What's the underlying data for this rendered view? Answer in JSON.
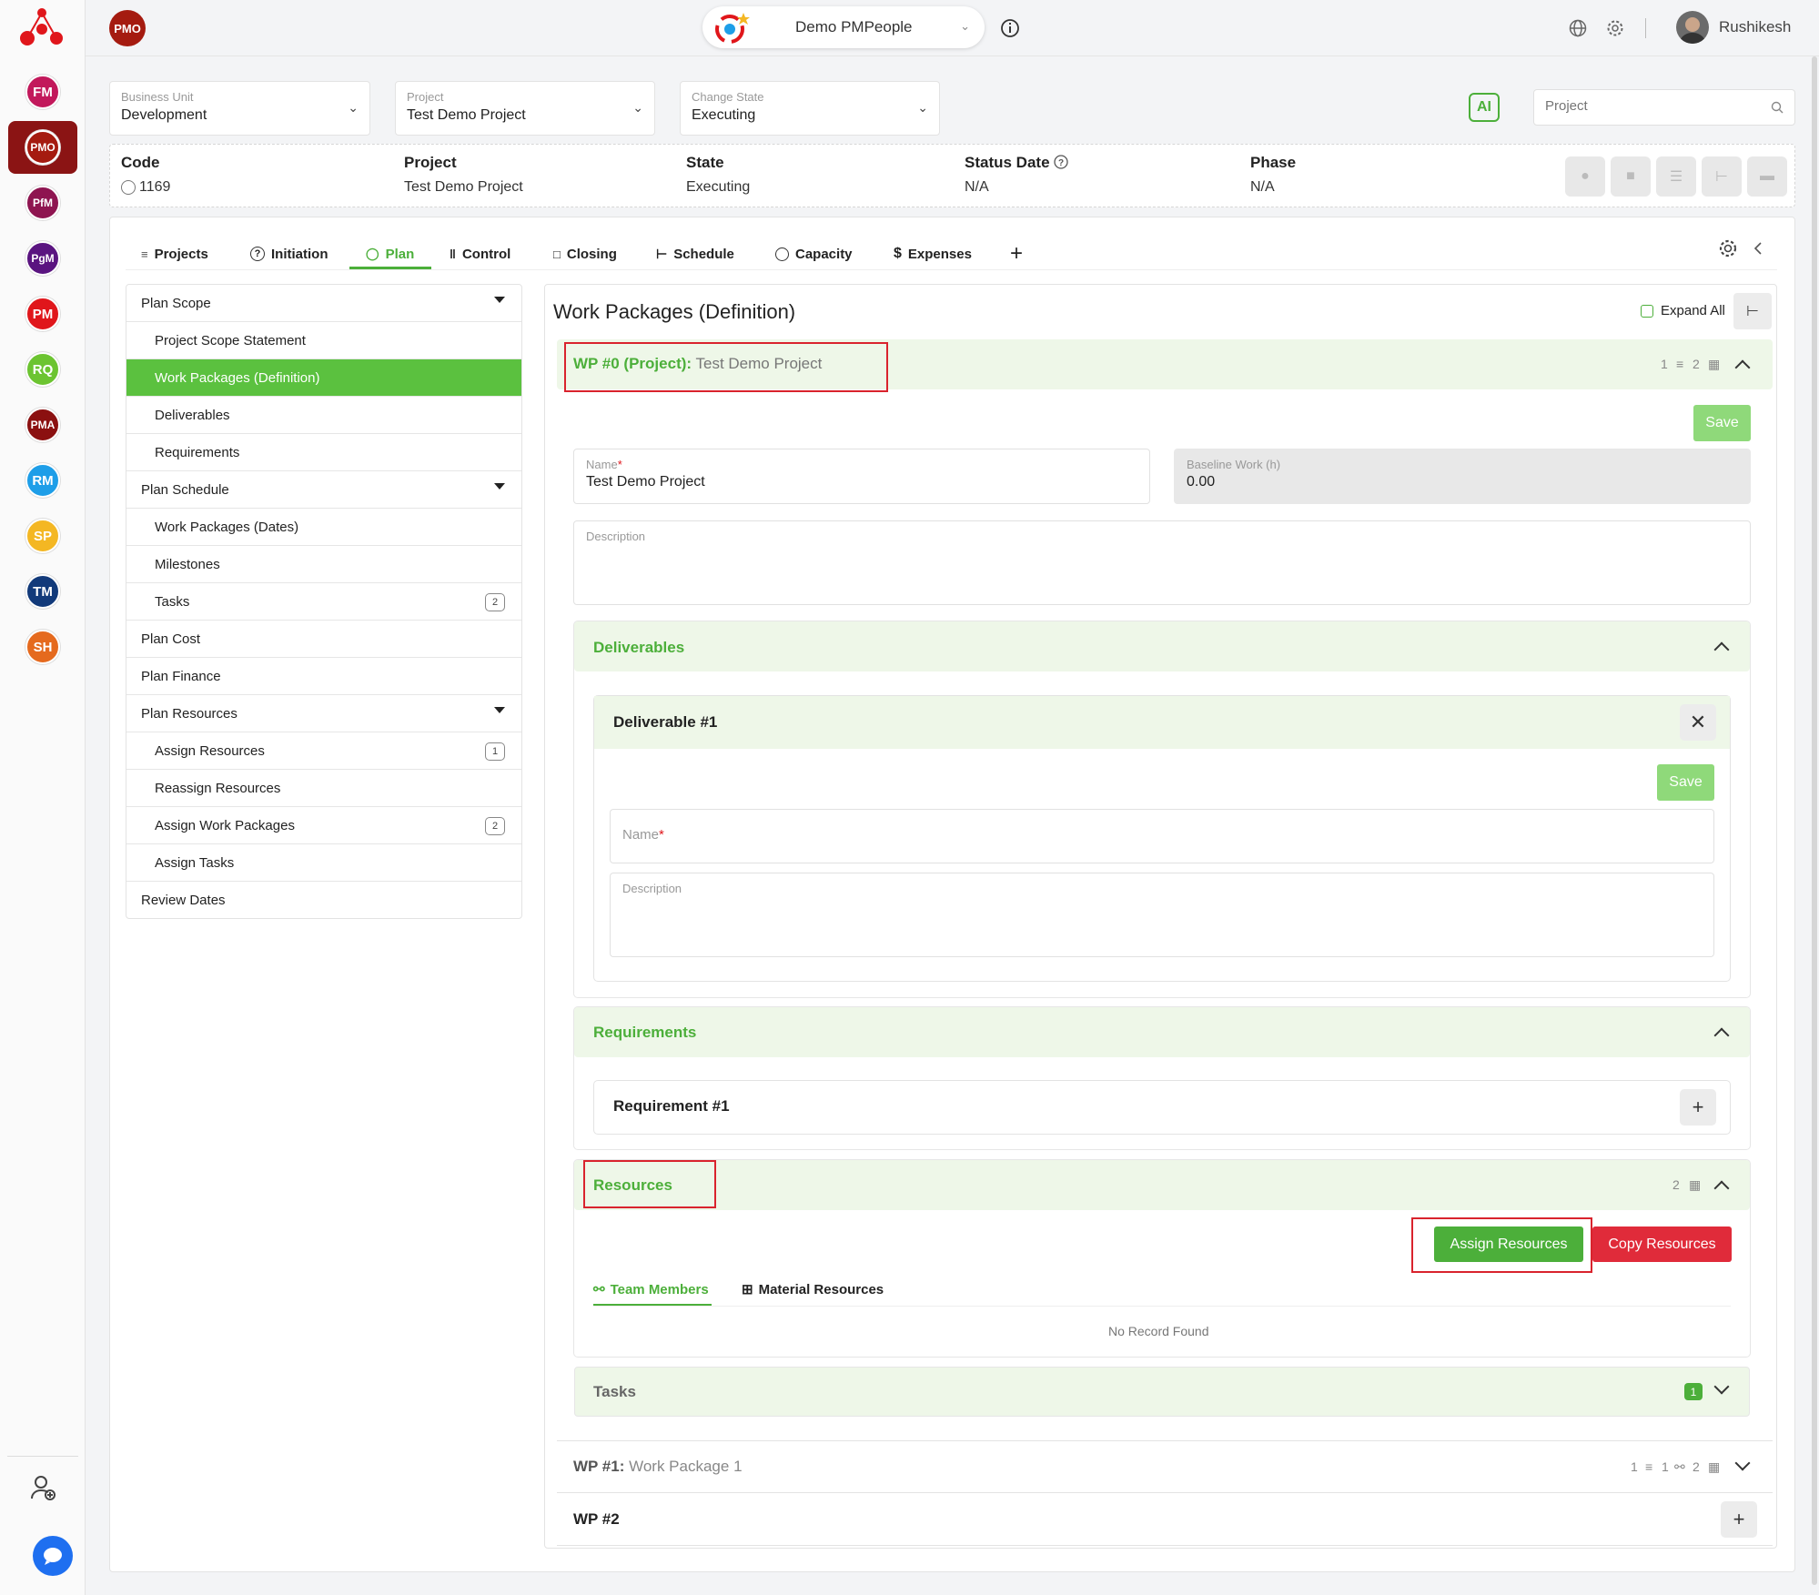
{
  "rail": {
    "items": [
      {
        "label": "FM",
        "color": "#c2185b"
      },
      {
        "label": "PMO",
        "color": "#a51b10"
      },
      {
        "label": "PfM",
        "color": "#8e1450"
      },
      {
        "label": "PgM",
        "color": "#5a1480"
      },
      {
        "label": "PM",
        "color": "#e0161b"
      },
      {
        "label": "RQ",
        "color": "#6cc431"
      },
      {
        "label": "PMA",
        "color": "#8b1010"
      },
      {
        "label": "RM",
        "color": "#1e9ee8"
      },
      {
        "label": "SP",
        "color": "#f4b723"
      },
      {
        "label": "TM",
        "color": "#123a7a"
      },
      {
        "label": "SH",
        "color": "#e56a1e"
      }
    ]
  },
  "topbar": {
    "module_badge": "PMO",
    "workspace": "Demo PMPeople",
    "user": "Rushikesh"
  },
  "filters": {
    "business_unit": {
      "label": "Business Unit",
      "value": "Development"
    },
    "project": {
      "label": "Project",
      "value": "Test Demo Project"
    },
    "change_state": {
      "label": "Change State",
      "value": "Executing"
    },
    "search_placeholder": "Project",
    "ai_label": "AI"
  },
  "info": {
    "code": {
      "h": "Code",
      "v": "1169"
    },
    "project": {
      "h": "Project",
      "v": "Test Demo Project"
    },
    "state": {
      "h": "State",
      "v": "Executing"
    },
    "status_date": {
      "h": "Status Date",
      "v": "N/A"
    },
    "phase": {
      "h": "Phase",
      "v": "N/A"
    }
  },
  "tabs": [
    "Projects",
    "Initiation",
    "Plan",
    "Control",
    "Closing",
    "Schedule",
    "Capacity",
    "Expenses"
  ],
  "side": {
    "plan_scope": "Plan Scope",
    "project_scope_statement": "Project Scope Statement",
    "work_packages_definition": "Work Packages (Definition)",
    "deliverables": "Deliverables",
    "requirements": "Requirements",
    "plan_schedule": "Plan Schedule",
    "work_packages_dates": "Work Packages (Dates)",
    "milestones": "Milestones",
    "tasks": "Tasks",
    "tasks_count": "2",
    "plan_cost": "Plan Cost",
    "plan_finance": "Plan Finance",
    "plan_resources": "Plan Resources",
    "assign_resources": "Assign Resources",
    "assign_resources_count": "1",
    "reassign_resources": "Reassign Resources",
    "assign_work_packages": "Assign Work Packages",
    "assign_work_packages_count": "2",
    "assign_tasks": "Assign Tasks",
    "review_dates": "Review Dates"
  },
  "content": {
    "title": "Work Packages (Definition)",
    "expand_all": "Expand All",
    "wp0": {
      "prefix": "WP #0 (Project):",
      "name": "Test Demo Project",
      "meta1": "1",
      "meta2": "2"
    },
    "save": "Save",
    "name_label": "Name",
    "name_value": "Test Demo Project",
    "baseline_label": "Baseline Work (h)",
    "baseline_value": "0.00",
    "description_label": "Description",
    "deliverables": {
      "title": "Deliverables",
      "card": "Deliverable #1",
      "save": "Save",
      "name_label": "Name",
      "description_label": "Description"
    },
    "requirements": {
      "title": "Requirements",
      "card": "Requirement #1"
    },
    "resources": {
      "title": "Resources",
      "count": "2",
      "assign": "Assign Resources",
      "copy": "Copy Resources",
      "tab_team": "Team Members",
      "tab_material": "Material Resources",
      "empty": "No Record Found"
    },
    "tasks": {
      "title": "Tasks",
      "count": "1"
    },
    "wp1": {
      "prefix": "WP #1:",
      "name": "Work Package 1",
      "meta1": "1",
      "meta2": "1",
      "meta3": "2"
    },
    "wp2": {
      "prefix": "WP #2"
    }
  }
}
